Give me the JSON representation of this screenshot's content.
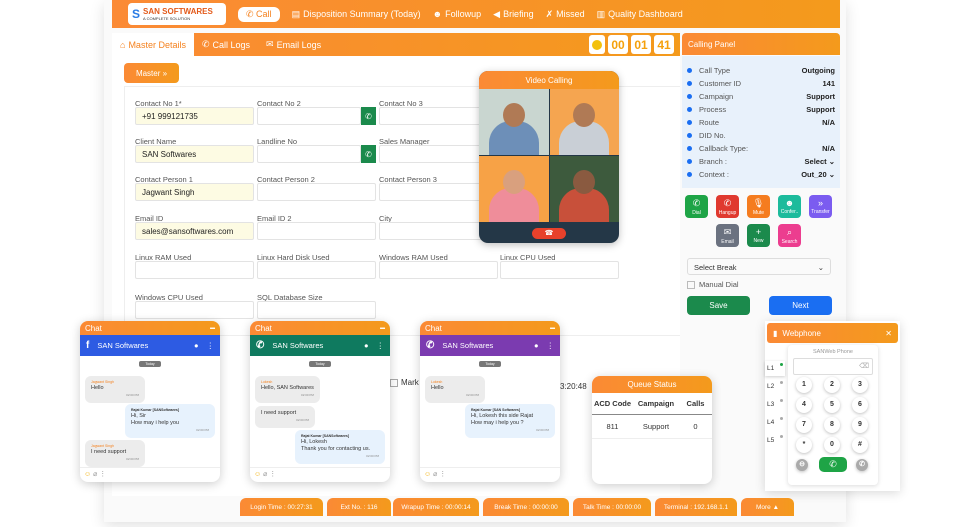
{
  "nav": {
    "brand": "SAN SOFTWARES",
    "brand_tagline": "A COMPLETE SOLUTION",
    "call": "Call",
    "items": [
      "Disposition Summary (Today)",
      "Followup",
      "Briefing",
      "Missed",
      "Quality Dashboard"
    ]
  },
  "tabs": [
    "Master Details",
    "Call Logs",
    "Email Logs"
  ],
  "timer": [
    "00",
    "01",
    "41"
  ],
  "master_label": "Master",
  "form": [
    {
      "label": "Contact No 1*",
      "value": "+91 999121735"
    },
    {
      "label": "Contact No 2",
      "value": ""
    },
    {
      "label": "Contact No 3",
      "value": ""
    },
    {
      "label": "Client Name",
      "value": "SAN Softwares"
    },
    {
      "label": "Landline No",
      "value": ""
    },
    {
      "label": "Sales Manager",
      "value": ""
    },
    {
      "label": "Contact Person 1",
      "value": "Jagwant Singh"
    },
    {
      "label": "Contact Person 2",
      "value": ""
    },
    {
      "label": "Contact Person 3",
      "value": ""
    },
    {
      "label": "Email ID",
      "value": "sales@sansoftwares.com"
    },
    {
      "label": "Email ID 2",
      "value": ""
    },
    {
      "label": "City",
      "value": ""
    },
    {
      "label": "Linux RAM Used",
      "value": ""
    },
    {
      "label": "Linux Hard Disk Used",
      "value": ""
    },
    {
      "label": "Windows RAM Used",
      "value": ""
    },
    {
      "label": "Linux CPU Used",
      "value": ""
    },
    {
      "label": "Windows CPU Used",
      "value": ""
    },
    {
      "label": "SQL Database Size",
      "value": ""
    }
  ],
  "hidden_row": {
    "mark": "Mark",
    "time": "3:20:48"
  },
  "video": {
    "title": "Video Calling"
  },
  "calling_panel": {
    "title": "Calling Panel",
    "rows": [
      {
        "k": "Call Type",
        "v": "Outgoing"
      },
      {
        "k": "Customer ID",
        "v": "141"
      },
      {
        "k": "Campaign",
        "v": "Support"
      },
      {
        "k": "Process",
        "v": "Support"
      },
      {
        "k": "Route",
        "v": "N/A"
      },
      {
        "k": "DID No.",
        "v": ""
      },
      {
        "k": "Callback Type:",
        "v": "N/A"
      },
      {
        "k": "Branch :",
        "v": "Select ⌄"
      },
      {
        "k": "Context :",
        "v": "Out_20 ⌄"
      }
    ],
    "actions": [
      {
        "label": "Dial",
        "color": "#1ea446"
      },
      {
        "label": "Hangup",
        "color": "#e0392f"
      },
      {
        "label": "Mute",
        "color": "#f57c1f"
      },
      {
        "label": "Confer..",
        "color": "#1dbb9c"
      },
      {
        "label": "Transfer",
        "color": "#7b5cf0"
      },
      {
        "label": "Email",
        "color": "#6b7280"
      },
      {
        "label": "New",
        "color": "#1b8a4c"
      },
      {
        "label": "Search",
        "color": "#ec3d8f"
      }
    ],
    "break_select": "Select Break",
    "manual_dial": "Manual Dial",
    "save": "Save",
    "next": "Next"
  },
  "chats": [
    {
      "title": "Chat",
      "name": "SAN Softwares",
      "color": "#2d5be3",
      "icon": "f",
      "today": "Today",
      "messages": [
        {
          "dir": "in",
          "sender": "Jagwant Singh",
          "text": "Hello",
          "time": "02:00 PM"
        },
        {
          "dir": "out",
          "sender": "Rajat Kumar [SANSoftwares]",
          "text": "Hi, Sir\nHow may i help you",
          "time": "02:00 PM"
        },
        {
          "dir": "in",
          "sender": "Jagwant Singh",
          "text": "I need support",
          "time": "02:00 PM"
        }
      ]
    },
    {
      "title": "Chat",
      "name": "SAN Softwares",
      "color": "#0f7a5f",
      "icon": "✆",
      "today": "Today",
      "messages": [
        {
          "dir": "in",
          "sender": "Lokesh",
          "text": "Hello, SAN Softwares",
          "time": "02:00 PM"
        },
        {
          "dir": "in",
          "sender": "",
          "text": "I need support",
          "time": "02:00 PM"
        },
        {
          "dir": "out",
          "sender": "Rajat Kumar [SANSoftwares]",
          "text": "Hi, Lokesh\nThank you for contacting us.",
          "time": "02:00 PM"
        }
      ]
    },
    {
      "title": "Chat",
      "name": "SAN Softwares",
      "color": "#7b3bb0",
      "icon": "✆",
      "today": "Today",
      "messages": [
        {
          "dir": "in",
          "sender": "Lokesh",
          "text": "Hello",
          "time": "02:00 PM"
        },
        {
          "dir": "out",
          "sender": "Rajat Kumar [SAN Softwares]",
          "text": "Hi, Lokesh this side Rajat\nHow may i help you ?",
          "time": "02:00 PM"
        }
      ]
    }
  ],
  "queue": {
    "title": "Queue Status",
    "headers": [
      "ACD Code",
      "Campaign",
      "Calls"
    ],
    "rows": [
      [
        "811",
        "Support",
        "0"
      ]
    ]
  },
  "webphone": {
    "title": "Webphone",
    "subtitle": "SANWeb Phone",
    "lines": [
      "L1",
      "L2",
      "L3",
      "L4",
      "L5"
    ],
    "keys": [
      "1",
      "2",
      "3",
      "4",
      "5",
      "6",
      "7",
      "8",
      "9",
      "*",
      "0",
      "#"
    ]
  },
  "status": [
    "Login Time : 00:27:31",
    "Ext No. : 116",
    "Wrapup Time : 00:00:14",
    "Break Time : 00:00:00",
    "Talk Time : 00:00:00",
    "Terminal : 192.168.1.1",
    "More ▲"
  ],
  "colors": {
    "accent": "#f5821f",
    "blue": "#1a6ef2",
    "green": "#1b8a4c"
  }
}
